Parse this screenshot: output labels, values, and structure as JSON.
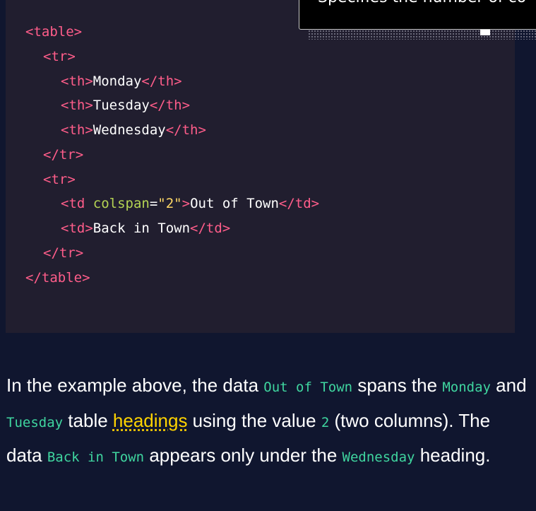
{
  "code_example": {
    "lines": {
      "l1": {
        "open": "<table>"
      },
      "l2": {
        "open": "<tr>"
      },
      "l3": {
        "open": "<th>",
        "text": "Monday",
        "close": "</th>"
      },
      "l4": {
        "open": "<th>",
        "text": "Tuesday",
        "close": "</th>"
      },
      "l5": {
        "open": "<th>",
        "text": "Wednesday",
        "close": "</th>"
      },
      "l6": {
        "open": "</tr>"
      },
      "l7": {
        "open": "<tr>"
      },
      "l8": {
        "tag_start": "<td ",
        "attr": "colspan",
        "eq": "=",
        "value": "\"2\"",
        "tag_end": ">",
        "text": "Out of Town",
        "close": "</td>"
      },
      "l9": {
        "open": "<td>",
        "text": "Back in Town",
        "close": "</td>"
      },
      "l10": {
        "open": "</tr>"
      },
      "l11": {
        "open": "</table>"
      }
    }
  },
  "tooltip": {
    "text": "Specifies the number of co"
  },
  "explanation": {
    "t1": "In the example above, the data ",
    "c1": "Out of Town",
    "t2": " spans the ",
    "c2": "Monday",
    "t3": " and ",
    "c3": "Tuesday",
    "t4": " table ",
    "link": "headings",
    "t5": " using the value ",
    "c4": "2",
    "t6": " (two columns). The data ",
    "c5": "Back in Town",
    "t7": " appears only under the ",
    "c6": "Wednesday",
    "t8": " heading."
  },
  "colors": {
    "page_bg": "#10162f",
    "code_bg": "#211e2f",
    "tag": "#ff5d8a",
    "attr": "#b4d353",
    "string": "#ffd866",
    "inline_code": "#3fd59f",
    "link": "#ffd300"
  }
}
